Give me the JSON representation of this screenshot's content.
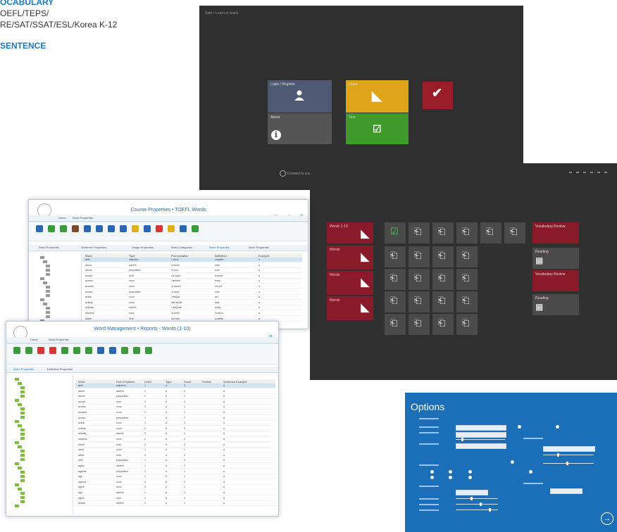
{
  "top_left": {
    "heading1": "OCABULARY",
    "line1": "OEFL/TEPS/",
    "line2": "RE/SAT/SSAT/ESL/Korea K-12",
    "heading2": "SENTENCE"
  },
  "launcher": {
    "title": "Start • Learn or teach",
    "footer": "Connect to a web site",
    "tiles": [
      {
        "label": "Login / Register",
        "icon": "user-icon"
      },
      {
        "label": "Learn",
        "icon": "books-icon"
      },
      {
        "label": "Check",
        "icon": "check-icon"
      },
      {
        "label": "About",
        "icon": "info-icon"
      },
      {
        "label": "Test",
        "icon": "test-icon"
      }
    ]
  },
  "lessons": {
    "left_tiles": [
      {
        "label": "Words 1-10"
      },
      {
        "label": "Words"
      },
      {
        "label": "Words"
      },
      {
        "label": "Words"
      }
    ],
    "right_tiles": [
      {
        "label": "Vocabulary Review",
        "color": "#8a1a2a"
      },
      {
        "label": "Reading",
        "color": "#4a4a4a"
      },
      {
        "label": "Vocabulary Review",
        "color": "#8a1a2a"
      },
      {
        "label": "Reading",
        "color": "#4a4a4a"
      }
    ]
  },
  "window1": {
    "title": "Course Properties • TOEFL Words",
    "tabs": [
      "Home",
      "Word Properties"
    ],
    "subtabs": [
      "Word Properties",
      "Sentence Properties",
      "Usage Properties",
      "Word Categories",
      "Word Properties",
      "Word Properties"
    ],
    "columns": [
      "Word",
      "Type",
      "Pronunciation",
      "Definition",
      "Example"
    ],
    "rows": [
      [
        "able",
        "adjective",
        "/ˈeɪbəl/",
        "capable",
        "a"
      ],
      [
        "about",
        "adverb",
        "/əˈbaʊt/",
        "near",
        "a"
      ],
      [
        "above",
        "preposition",
        "/əˈbʌv/",
        "over",
        "a"
      ],
      [
        "accept",
        "verb",
        "/əkˈsept/",
        "receive",
        "a"
      ],
      [
        "access",
        "noun",
        "/ˈækses/",
        "entry",
        "a"
      ],
      [
        "account",
        "noun",
        "/əˈkaʊnt/",
        "record",
        "a"
      ],
      [
        "across",
        "preposition",
        "/əˈkrɒs/",
        "over",
        "a"
      ],
      [
        "action",
        "noun",
        "/ˈækʃən/",
        "act",
        "a"
      ],
      [
        "activity",
        "noun",
        "/ækˈtɪvəti/",
        "task",
        "a"
      ],
      [
        "actually",
        "adverb",
        "/ˈæktʃuəli/",
        "really",
        "a"
      ],
      [
        "address",
        "noun",
        "/əˈdres/",
        "location",
        "a"
      ],
      [
        "admit",
        "verb",
        "/ədˈmɪt/",
        "confess",
        "a"
      ]
    ]
  },
  "window2": {
    "title": "Word Management • Reports - Words (1-10)",
    "tabs": [
      "Home",
      "Word Properties"
    ],
    "subtabs": [
      "Word Properties",
      "Definition Properties"
    ],
    "columns": [
      "Word",
      "Part of Speech",
      "Level",
      "Type",
      "Score",
      "Format",
      "Sentence Example"
    ],
    "rows": [
      [
        "able",
        "adjective",
        "1",
        "A",
        "3",
        "",
        "a"
      ],
      [
        "about",
        "adverb",
        "1",
        "A",
        "2",
        "",
        "a"
      ],
      [
        "above",
        "preposition",
        "1",
        "A",
        "2",
        "",
        "a"
      ],
      [
        "accept",
        "verb",
        "2",
        "A",
        "3",
        "",
        "a"
      ],
      [
        "access",
        "noun",
        "2",
        "A",
        "1",
        "",
        "a"
      ],
      [
        "account",
        "noun",
        "2",
        "A",
        "1",
        "",
        "a"
      ],
      [
        "across",
        "preposition",
        "1",
        "A",
        "2",
        "",
        "a"
      ],
      [
        "action",
        "noun",
        "1",
        "A",
        "3",
        "",
        "a"
      ],
      [
        "activity",
        "noun",
        "2",
        "A",
        "3",
        "",
        "a"
      ],
      [
        "actually",
        "adverb",
        "3",
        "A",
        "1",
        "",
        "a"
      ],
      [
        "address",
        "noun",
        "2",
        "A",
        "2",
        "",
        "a"
      ],
      [
        "admit",
        "verb",
        "2",
        "A",
        "2",
        "",
        "a"
      ],
      [
        "adult",
        "noun",
        "1",
        "A",
        "1",
        "",
        "a"
      ],
      [
        "affect",
        "verb",
        "3",
        "A",
        "2",
        "",
        "a"
      ],
      [
        "after",
        "preposition",
        "1",
        "A",
        "3",
        "",
        "a"
      ],
      [
        "again",
        "adverb",
        "1",
        "A",
        "2",
        "",
        "a"
      ],
      [
        "against",
        "preposition",
        "2",
        "A",
        "1",
        "",
        "a"
      ],
      [
        "age",
        "noun",
        "1",
        "A",
        "1",
        "",
        "a"
      ],
      [
        "agency",
        "noun",
        "3",
        "A",
        "2",
        "",
        "a"
      ],
      [
        "agent",
        "noun",
        "3",
        "A",
        "1",
        "",
        "a"
      ],
      [
        "ago",
        "adverb",
        "1",
        "A",
        "2",
        "",
        "a"
      ],
      [
        "agree",
        "verb",
        "1",
        "A",
        "3",
        "",
        "a"
      ],
      [
        "ahead",
        "adverb",
        "2",
        "A",
        "1",
        "",
        "a"
      ]
    ]
  },
  "options": {
    "title": "Options"
  }
}
